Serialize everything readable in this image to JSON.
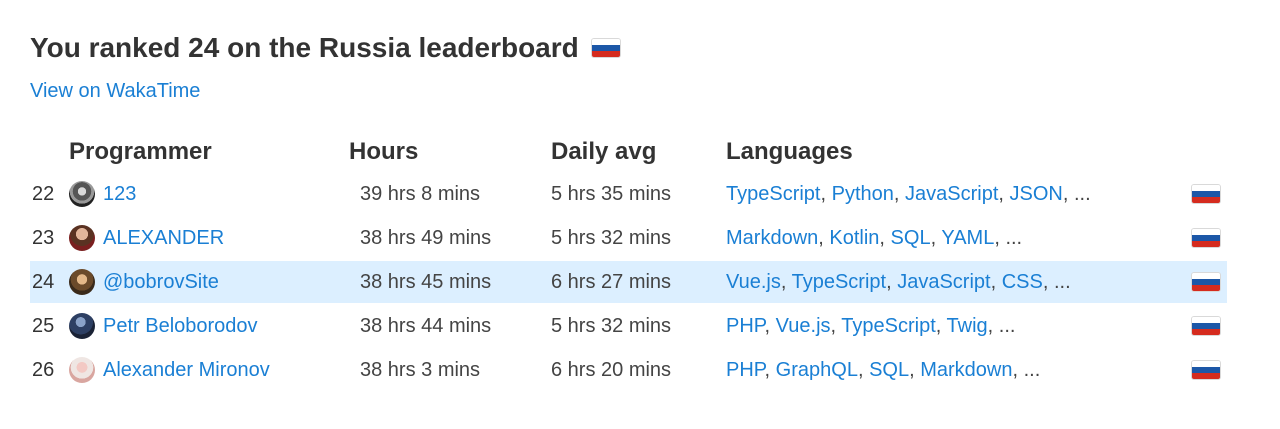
{
  "header": {
    "title": "You ranked 24 on the Russia leaderboard",
    "link_text": "View on WakaTime"
  },
  "table": {
    "columns": [
      "Programmer",
      "Hours",
      "Daily avg",
      "Languages"
    ],
    "rows": [
      {
        "rank": "22",
        "name": "123",
        "hours": "39 hrs 8 mins",
        "daily_avg": "5 hrs 35 mins",
        "languages": [
          "TypeScript",
          "Python",
          "JavaScript",
          "JSON"
        ],
        "more": ", ...",
        "highlighted": false
      },
      {
        "rank": "23",
        "name": "ALEXANDER",
        "hours": "38 hrs 49 mins",
        "daily_avg": "5 hrs 32 mins",
        "languages": [
          "Markdown",
          "Kotlin",
          "SQL",
          "YAML"
        ],
        "more": ", ...",
        "highlighted": false
      },
      {
        "rank": "24",
        "name": "@bobrovSite",
        "hours": "38 hrs 45 mins",
        "daily_avg": "6 hrs 27 mins",
        "languages": [
          "Vue.js",
          "TypeScript",
          "JavaScript",
          "CSS"
        ],
        "more": ", ...",
        "highlighted": true
      },
      {
        "rank": "25",
        "name": "Petr Beloborodov",
        "hours": "38 hrs 44 mins",
        "daily_avg": "5 hrs 32 mins",
        "languages": [
          "PHP",
          "Vue.js",
          "TypeScript",
          "Twig"
        ],
        "more": ", ...",
        "highlighted": false
      },
      {
        "rank": "26",
        "name": "Alexander Mironov",
        "hours": "38 hrs 3 mins",
        "daily_avg": "6 hrs 20 mins",
        "languages": [
          "PHP",
          "GraphQL",
          "SQL",
          "Markdown"
        ],
        "more": ", ...",
        "highlighted": false
      }
    ]
  },
  "icons": {
    "flag": "russia-flag-icon",
    "avatar": "user-avatar"
  },
  "colors": {
    "link": "#1a7fd4",
    "highlight": "#dcefff",
    "text": "#333333"
  }
}
